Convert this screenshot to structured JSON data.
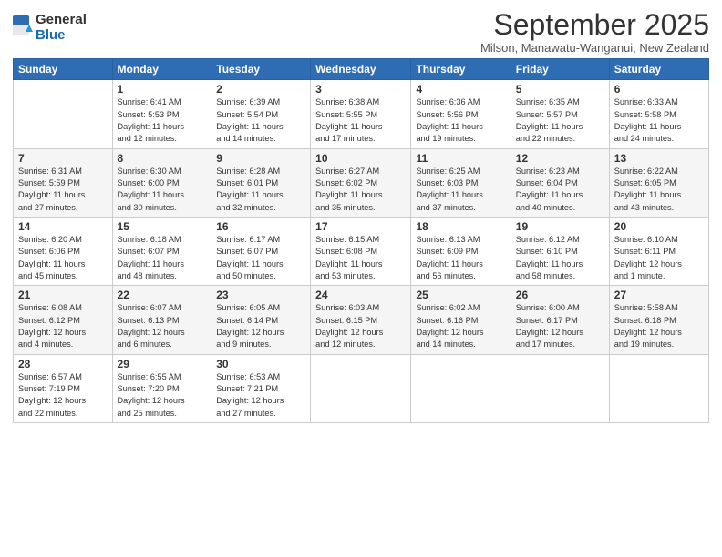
{
  "header": {
    "logo_general": "General",
    "logo_blue": "Blue",
    "month_title": "September 2025",
    "location": "Milson, Manawatu-Wanganui, New Zealand"
  },
  "days_of_week": [
    "Sunday",
    "Monday",
    "Tuesday",
    "Wednesday",
    "Thursday",
    "Friday",
    "Saturday"
  ],
  "weeks": [
    [
      {
        "day": "",
        "info": ""
      },
      {
        "day": "1",
        "info": "Sunrise: 6:41 AM\nSunset: 5:53 PM\nDaylight: 11 hours\nand 12 minutes."
      },
      {
        "day": "2",
        "info": "Sunrise: 6:39 AM\nSunset: 5:54 PM\nDaylight: 11 hours\nand 14 minutes."
      },
      {
        "day": "3",
        "info": "Sunrise: 6:38 AM\nSunset: 5:55 PM\nDaylight: 11 hours\nand 17 minutes."
      },
      {
        "day": "4",
        "info": "Sunrise: 6:36 AM\nSunset: 5:56 PM\nDaylight: 11 hours\nand 19 minutes."
      },
      {
        "day": "5",
        "info": "Sunrise: 6:35 AM\nSunset: 5:57 PM\nDaylight: 11 hours\nand 22 minutes."
      },
      {
        "day": "6",
        "info": "Sunrise: 6:33 AM\nSunset: 5:58 PM\nDaylight: 11 hours\nand 24 minutes."
      }
    ],
    [
      {
        "day": "7",
        "info": "Sunrise: 6:31 AM\nSunset: 5:59 PM\nDaylight: 11 hours\nand 27 minutes."
      },
      {
        "day": "8",
        "info": "Sunrise: 6:30 AM\nSunset: 6:00 PM\nDaylight: 11 hours\nand 30 minutes."
      },
      {
        "day": "9",
        "info": "Sunrise: 6:28 AM\nSunset: 6:01 PM\nDaylight: 11 hours\nand 32 minutes."
      },
      {
        "day": "10",
        "info": "Sunrise: 6:27 AM\nSunset: 6:02 PM\nDaylight: 11 hours\nand 35 minutes."
      },
      {
        "day": "11",
        "info": "Sunrise: 6:25 AM\nSunset: 6:03 PM\nDaylight: 11 hours\nand 37 minutes."
      },
      {
        "day": "12",
        "info": "Sunrise: 6:23 AM\nSunset: 6:04 PM\nDaylight: 11 hours\nand 40 minutes."
      },
      {
        "day": "13",
        "info": "Sunrise: 6:22 AM\nSunset: 6:05 PM\nDaylight: 11 hours\nand 43 minutes."
      }
    ],
    [
      {
        "day": "14",
        "info": "Sunrise: 6:20 AM\nSunset: 6:06 PM\nDaylight: 11 hours\nand 45 minutes."
      },
      {
        "day": "15",
        "info": "Sunrise: 6:18 AM\nSunset: 6:07 PM\nDaylight: 11 hours\nand 48 minutes."
      },
      {
        "day": "16",
        "info": "Sunrise: 6:17 AM\nSunset: 6:07 PM\nDaylight: 11 hours\nand 50 minutes."
      },
      {
        "day": "17",
        "info": "Sunrise: 6:15 AM\nSunset: 6:08 PM\nDaylight: 11 hours\nand 53 minutes."
      },
      {
        "day": "18",
        "info": "Sunrise: 6:13 AM\nSunset: 6:09 PM\nDaylight: 11 hours\nand 56 minutes."
      },
      {
        "day": "19",
        "info": "Sunrise: 6:12 AM\nSunset: 6:10 PM\nDaylight: 11 hours\nand 58 minutes."
      },
      {
        "day": "20",
        "info": "Sunrise: 6:10 AM\nSunset: 6:11 PM\nDaylight: 12 hours\nand 1 minute."
      }
    ],
    [
      {
        "day": "21",
        "info": "Sunrise: 6:08 AM\nSunset: 6:12 PM\nDaylight: 12 hours\nand 4 minutes."
      },
      {
        "day": "22",
        "info": "Sunrise: 6:07 AM\nSunset: 6:13 PM\nDaylight: 12 hours\nand 6 minutes."
      },
      {
        "day": "23",
        "info": "Sunrise: 6:05 AM\nSunset: 6:14 PM\nDaylight: 12 hours\nand 9 minutes."
      },
      {
        "day": "24",
        "info": "Sunrise: 6:03 AM\nSunset: 6:15 PM\nDaylight: 12 hours\nand 12 minutes."
      },
      {
        "day": "25",
        "info": "Sunrise: 6:02 AM\nSunset: 6:16 PM\nDaylight: 12 hours\nand 14 minutes."
      },
      {
        "day": "26",
        "info": "Sunrise: 6:00 AM\nSunset: 6:17 PM\nDaylight: 12 hours\nand 17 minutes."
      },
      {
        "day": "27",
        "info": "Sunrise: 5:58 AM\nSunset: 6:18 PM\nDaylight: 12 hours\nand 19 minutes."
      }
    ],
    [
      {
        "day": "28",
        "info": "Sunrise: 6:57 AM\nSunset: 7:19 PM\nDaylight: 12 hours\nand 22 minutes."
      },
      {
        "day": "29",
        "info": "Sunrise: 6:55 AM\nSunset: 7:20 PM\nDaylight: 12 hours\nand 25 minutes."
      },
      {
        "day": "30",
        "info": "Sunrise: 6:53 AM\nSunset: 7:21 PM\nDaylight: 12 hours\nand 27 minutes."
      },
      {
        "day": "",
        "info": ""
      },
      {
        "day": "",
        "info": ""
      },
      {
        "day": "",
        "info": ""
      },
      {
        "day": "",
        "info": ""
      }
    ]
  ]
}
